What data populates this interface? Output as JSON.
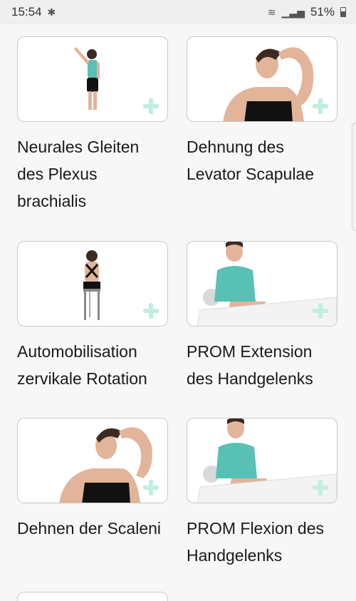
{
  "status_bar": {
    "time": "15:54",
    "battery_percent": "51%",
    "icons": [
      "bluetooth-icon",
      "wifi-icon",
      "signal-icon",
      "battery-icon"
    ]
  },
  "exercises": [
    {
      "title": "Neurales Gleiten des Plexus brachialis",
      "image": "standing-arm-raised"
    },
    {
      "title": "Dehnung des Levator Scapulae",
      "image": "neck-stretch"
    },
    {
      "title": "Automobilisation zervikale Rotation",
      "image": "seated-back-view"
    },
    {
      "title": "PROM Extension des Handgelenks",
      "image": "seated-wrist-extension"
    },
    {
      "title": "Dehnen der Scaleni",
      "image": "neck-side-stretch"
    },
    {
      "title": "PROM Flexion des Handgelenks",
      "image": "seated-wrist-flexion"
    }
  ],
  "accent_colors": {
    "plus": "#bfeee3",
    "shirt": "#58c0b5"
  }
}
